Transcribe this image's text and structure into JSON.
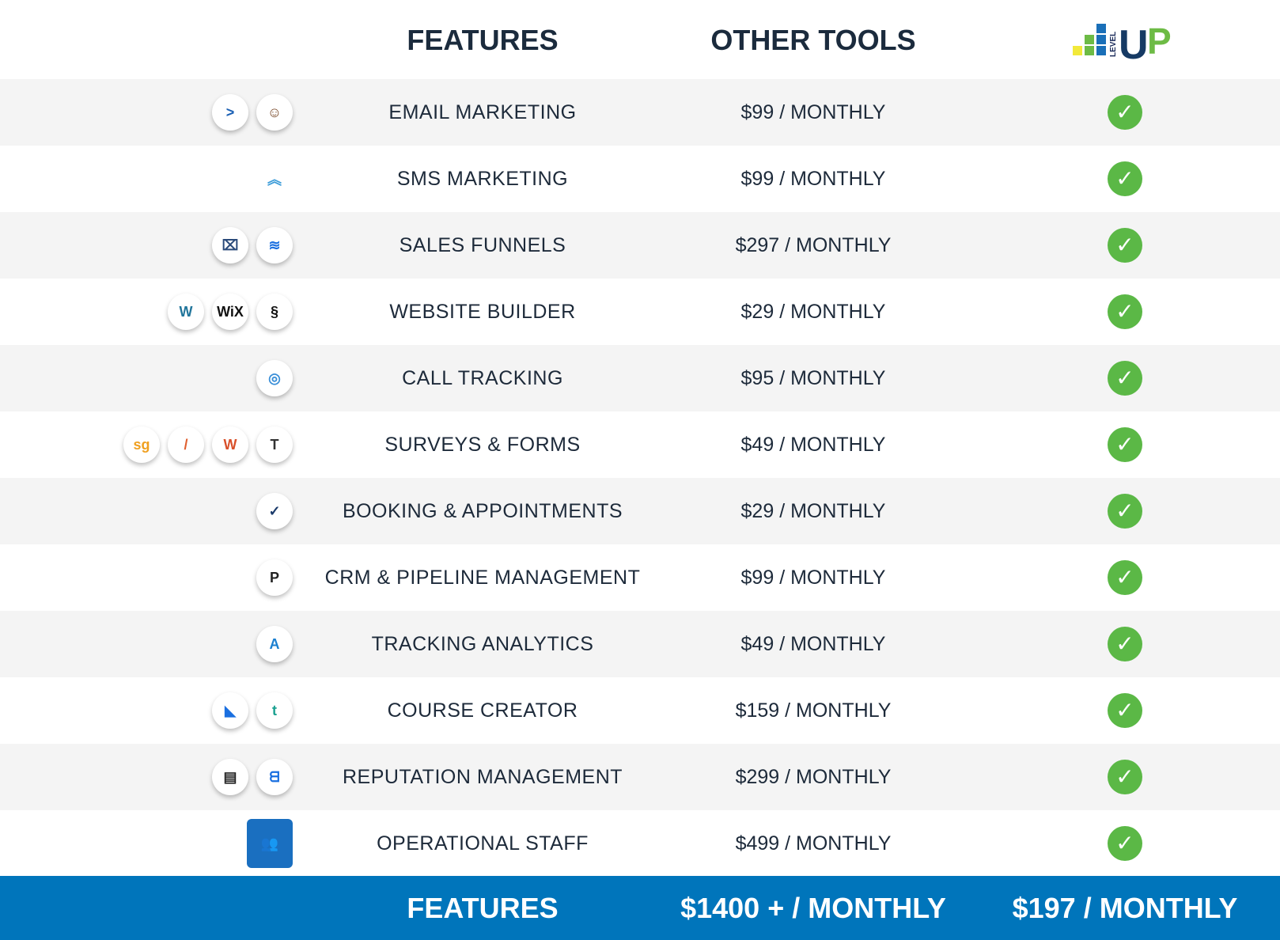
{
  "header": {
    "features": "FEATURES",
    "other_tools": "OTHER TOOLS",
    "logo_text": "LEVEL UP"
  },
  "rows": [
    {
      "feature": "EMAIL MARKETING",
      "price": "$99 / MONTHLY",
      "icons": [
        {
          "name": "activecampaign-icon",
          "glyph": ">",
          "color": "#1a5fb4"
        },
        {
          "name": "mailchimp-icon",
          "glyph": "☺",
          "color": "#7a4a2a"
        }
      ]
    },
    {
      "feature": "SMS MARKETING",
      "price": "$99 / MONTHLY",
      "icons": [
        {
          "name": "chevrons-up-icon",
          "glyph": "︽",
          "color": "#3a9bd8",
          "plain": true
        }
      ]
    },
    {
      "feature": "SALES FUNNELS",
      "price": "$297 / MONTHLY",
      "icons": [
        {
          "name": "clickfunnels-icon",
          "glyph": "⌧",
          "color": "#2a4a7a"
        },
        {
          "name": "layers-icon",
          "glyph": "≋",
          "color": "#1a6fe0"
        }
      ]
    },
    {
      "feature": "WEBSITE BUILDER",
      "price": "$29 / MONTHLY",
      "icons": [
        {
          "name": "wordpress-icon",
          "glyph": "W",
          "color": "#21759b"
        },
        {
          "name": "wix-icon",
          "glyph": "WiX",
          "color": "#111"
        },
        {
          "name": "squarespace-icon",
          "glyph": "§",
          "color": "#111"
        }
      ]
    },
    {
      "feature": "CALL TRACKING",
      "price": "$95 / MONTHLY",
      "icons": [
        {
          "name": "callrail-icon",
          "glyph": "◎",
          "color": "#3a8fd8"
        }
      ]
    },
    {
      "feature": "SURVEYS & FORMS",
      "price": "$49 / MONTHLY",
      "icons": [
        {
          "name": "surveygizmo-icon",
          "glyph": "sg",
          "color": "#f0a020"
        },
        {
          "name": "jotform-icon",
          "glyph": "/",
          "color": "#e06030"
        },
        {
          "name": "wufoo-icon",
          "glyph": "W",
          "color": "#d9502a"
        },
        {
          "name": "typeform-icon",
          "glyph": "T",
          "color": "#333"
        }
      ]
    },
    {
      "feature": "BOOKING & APPOINTMENTS",
      "price": "$29 / MONTHLY",
      "icons": [
        {
          "name": "calendly-icon",
          "glyph": "✓",
          "color": "#1a3a6a"
        }
      ]
    },
    {
      "feature": "CRM & PIPELINE MANAGEMENT",
      "price": "$99 / MONTHLY",
      "icons": [
        {
          "name": "pipedrive-icon",
          "glyph": "P",
          "color": "#222"
        }
      ]
    },
    {
      "feature": "TRACKING ANALYTICS",
      "price": "$49 / MONTHLY",
      "icons": [
        {
          "name": "analytics-icon",
          "glyph": "A",
          "color": "#1a7fd0"
        }
      ]
    },
    {
      "feature": "COURSE CREATOR",
      "price": "$159 / MONTHLY",
      "icons": [
        {
          "name": "kajabi-icon",
          "glyph": "◣",
          "color": "#1a6fe0"
        },
        {
          "name": "teachable-icon",
          "glyph": "t",
          "color": "#1aa090"
        }
      ]
    },
    {
      "feature": "REPUTATION MANAGEMENT",
      "price": "$299 / MONTHLY",
      "icons": [
        {
          "name": "podium-icon",
          "glyph": "▤",
          "color": "#222"
        },
        {
          "name": "birdeye-icon",
          "glyph": "ᗺ",
          "color": "#1a6fe0"
        }
      ]
    },
    {
      "feature": "OPERATIONAL STAFF",
      "price": "$499 / MONTHLY",
      "icons": [
        {
          "name": "staff-team-icon",
          "glyph": "👥",
          "color": "#fff",
          "square": true
        }
      ]
    }
  ],
  "footer": {
    "features": "FEATURES",
    "other_total": "$1400 + / MONTHLY",
    "levelup_total": "$197 / MONTHLY"
  },
  "colors": {
    "check": "#5bb846",
    "footer": "#0075bb",
    "alt_row": "#f4f4f4"
  }
}
